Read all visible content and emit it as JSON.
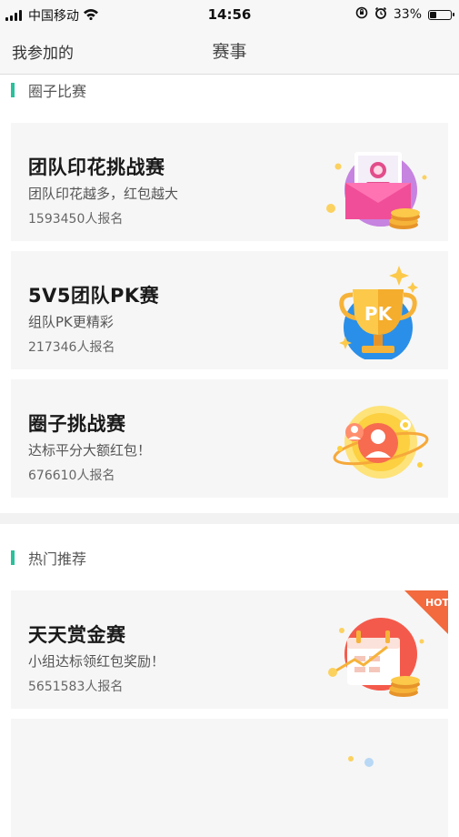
{
  "status_bar": {
    "carrier": "中国移动",
    "time": "14:56",
    "battery_percent": "33%",
    "battery_level": 0.33
  },
  "nav": {
    "left_label": "我参加的",
    "title": "赛事"
  },
  "sections": [
    {
      "title": "圈子比赛",
      "cards": [
        {
          "title": "团队印花挑战赛",
          "desc": "团队印花越多，红包越大",
          "count": "1593450人报名",
          "icon": "envelope-coins-icon"
        },
        {
          "title": "5V5团队PK赛",
          "desc": "组队PK更精彩",
          "count": "217346人报名",
          "icon": "pk-trophy-icon"
        },
        {
          "title": "圈子挑战赛",
          "desc": "达标平分大额红包！",
          "count": "676610人报名",
          "icon": "planet-people-icon"
        }
      ]
    },
    {
      "title": "热门推荐",
      "cards": [
        {
          "title": "天天赏金赛",
          "desc": "小组达标领红包奖励！",
          "count": "5651583人报名",
          "icon": "calendar-coins-icon",
          "badge": "HOT"
        }
      ]
    }
  ],
  "colors": {
    "accent": "#29c09a",
    "card_bg": "#f6f6f6",
    "hot_badge": "#f26a3d"
  }
}
